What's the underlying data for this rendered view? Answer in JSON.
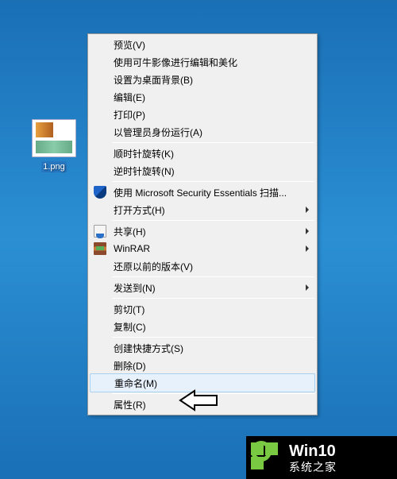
{
  "desktop": {
    "icon": {
      "label": "1.png"
    }
  },
  "context_menu": {
    "groups": [
      [
        {
          "label": "预览(V)",
          "key": "preview"
        },
        {
          "label": "使用可牛影像进行编辑和美化",
          "key": "keniu-edit"
        },
        {
          "label": "设置为桌面背景(B)",
          "key": "set-wallpaper"
        },
        {
          "label": "编辑(E)",
          "key": "edit"
        },
        {
          "label": "打印(P)",
          "key": "print"
        },
        {
          "label": "以管理员身份运行(A)",
          "key": "run-as-admin"
        }
      ],
      [
        {
          "label": "顺时针旋转(K)",
          "key": "rotate-cw"
        },
        {
          "label": "逆时针旋转(N)",
          "key": "rotate-ccw"
        }
      ],
      [
        {
          "label": "使用 Microsoft Security Essentials 扫描...",
          "key": "mse-scan",
          "icon": "shield"
        },
        {
          "label": "打开方式(H)",
          "key": "open-with",
          "submenu": true
        }
      ],
      [
        {
          "label": "共享(H)",
          "key": "share",
          "icon": "share",
          "submenu": true
        },
        {
          "label": "WinRAR",
          "key": "winrar",
          "icon": "winrar",
          "submenu": true
        },
        {
          "label": "还原以前的版本(V)",
          "key": "restore-versions"
        }
      ],
      [
        {
          "label": "发送到(N)",
          "key": "send-to",
          "submenu": true
        }
      ],
      [
        {
          "label": "剪切(T)",
          "key": "cut"
        },
        {
          "label": "复制(C)",
          "key": "copy"
        }
      ],
      [
        {
          "label": "创建快捷方式(S)",
          "key": "create-shortcut"
        },
        {
          "label": "删除(D)",
          "key": "delete"
        },
        {
          "label": "重命名(M)",
          "key": "rename",
          "highlighted": true
        }
      ],
      [
        {
          "label": "属性(R)",
          "key": "properties"
        }
      ]
    ]
  },
  "branding": {
    "line1": "Win10",
    "line2": "系统之家"
  }
}
